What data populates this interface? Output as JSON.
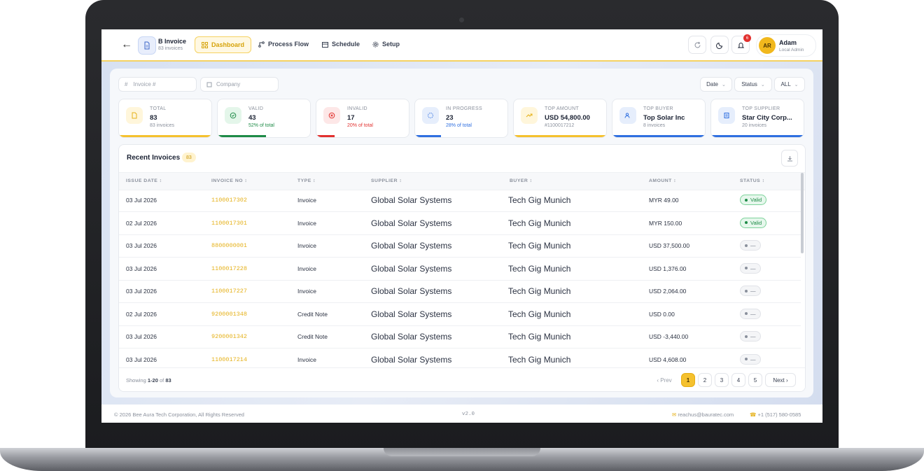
{
  "header": {
    "app_title": "B Invoice",
    "app_subtitle": "83 invoices",
    "nav": [
      "Dashboard",
      "Process Flow",
      "Schedule",
      "Setup"
    ],
    "notification_count": "6",
    "user_initials": "AR",
    "user_name": "Adam",
    "user_role": "Local Admin"
  },
  "filters": {
    "invoice_placeholder": "Invoice #",
    "company_placeholder": "Company",
    "date": "Date",
    "status": "Status",
    "all": "ALL"
  },
  "cards": [
    {
      "label": "TOTAL",
      "value": "83",
      "sub": "83 invoices",
      "color": "#f5c12e",
      "fill": 1.0
    },
    {
      "label": "VALID",
      "value": "43",
      "sub": "52% of total",
      "color": "#1e8b47",
      "fill": 0.52
    },
    {
      "label": "INVALID",
      "value": "17",
      "sub": "20% of total",
      "color": "#e2312f",
      "fill": 0.2
    },
    {
      "label": "IN PROGRESS",
      "value": "23",
      "sub": "28% of total",
      "color": "#2f6fe0",
      "fill": 0.28
    },
    {
      "label": "TOP AMOUNT",
      "value": "USD 54,800.00",
      "sub": "#1100017212",
      "color": "#f5c12e",
      "fill": 1.0
    },
    {
      "label": "TOP BUYER",
      "value": "Top Solar Inc",
      "sub": "8 invoices",
      "color": "#2f6fe0",
      "fill": 1.0
    },
    {
      "label": "TOP SUPPLIER",
      "value": "Star City Corp...",
      "sub": "20 invoices",
      "color": "#2f6fe0",
      "fill": 1.0
    }
  ],
  "table": {
    "title": "Recent Invoices",
    "count": "83",
    "columns": [
      "ISSUE DATE",
      "INVOICE NO",
      "TYPE",
      "SUPPLIER",
      "BUYER",
      "AMOUNT",
      "STATUS"
    ],
    "rows": [
      {
        "date": "03 Jul 2026",
        "invoice": "1100017302",
        "type": "Invoice",
        "supplier": "Global Solar Systems",
        "buyer": "Tech Gig Munich",
        "amount": "MYR 49.00",
        "status": "Valid"
      },
      {
        "date": "02 Jul 2026",
        "invoice": "1100017301",
        "type": "Invoice",
        "supplier": "Global Solar Systems",
        "buyer": "Tech Gig Munich",
        "amount": "MYR 150.00",
        "status": "Valid"
      },
      {
        "date": "03 Jul 2026",
        "invoice": "8800000001",
        "type": "Invoice",
        "supplier": "Global Solar Systems",
        "buyer": "Tech Gig Munich",
        "amount": "USD 37,500.00",
        "status": "—"
      },
      {
        "date": "03 Jul 2026",
        "invoice": "1100017228",
        "type": "Invoice",
        "supplier": "Global Solar Systems",
        "buyer": "Tech Gig Munich",
        "amount": "USD 1,376.00",
        "status": "—"
      },
      {
        "date": "03 Jul 2026",
        "invoice": "1100017227",
        "type": "Invoice",
        "supplier": "Global Solar Systems",
        "buyer": "Tech Gig Munich",
        "amount": "USD 2,064.00",
        "status": "—"
      },
      {
        "date": "02 Jul 2026",
        "invoice": "9200001348",
        "type": "Credit Note",
        "supplier": "Global Solar Systems",
        "buyer": "Tech Gig Munich",
        "amount": "USD 0.00",
        "status": "—"
      },
      {
        "date": "03 Jul 2026",
        "invoice": "9200001342",
        "type": "Credit Note",
        "supplier": "Global Solar Systems",
        "buyer": "Tech Gig Munich",
        "amount": "USD -3,440.00",
        "status": "—"
      },
      {
        "date": "03 Jul 2026",
        "invoice": "1100017214",
        "type": "Invoice",
        "supplier": "Global Solar Systems",
        "buyer": "Tech Gig Munich",
        "amount": "USD 4,608.00",
        "status": "—"
      }
    ],
    "showing_prefix": "Showing",
    "showing_range": "1-20",
    "showing_of": "of",
    "showing_total": "83"
  },
  "pagination": {
    "prev": "Prev",
    "pages": [
      "1",
      "2",
      "3",
      "4",
      "5"
    ],
    "next": "Next"
  },
  "footer": {
    "copyright": "© 2026 Bee Aura Tech Corporation, All Rights Reserved",
    "version": "v2.0",
    "email": "reachus@bauratec.com",
    "phone": "+1 (517) 580-0585"
  }
}
